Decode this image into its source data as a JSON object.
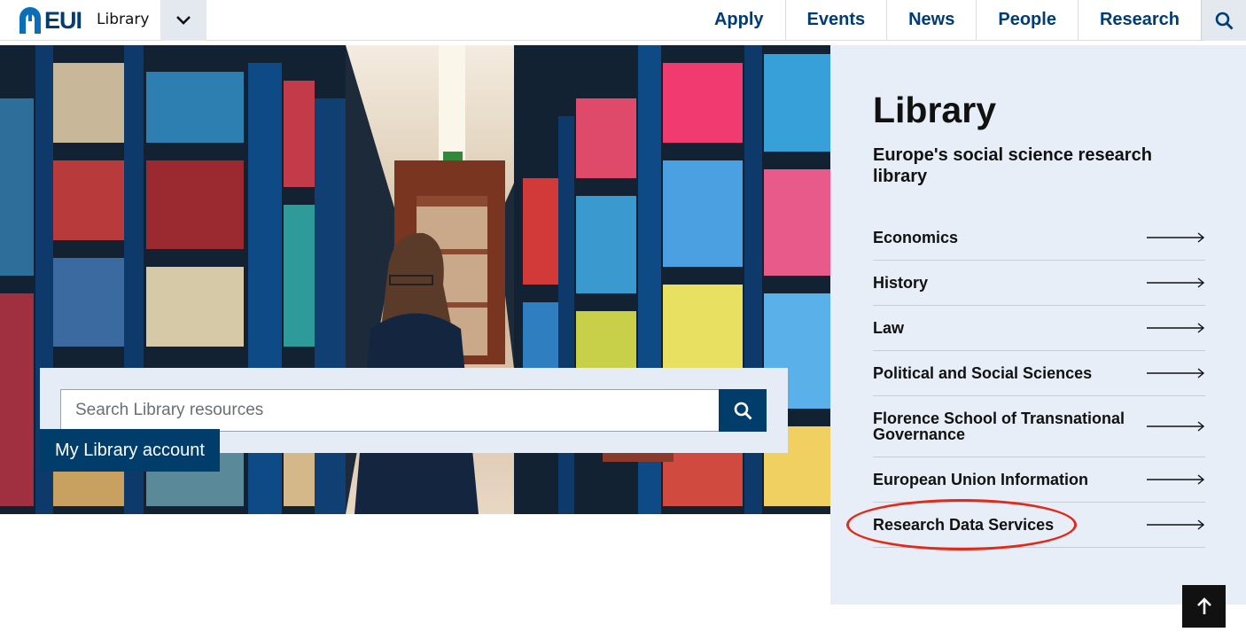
{
  "header": {
    "logo_text": "EUI",
    "site_name": "Library",
    "dropdown_icon": "chevron-down-icon",
    "nav": [
      "Apply",
      "Events",
      "News",
      "People",
      "Research"
    ],
    "search_icon": "search-icon"
  },
  "hero": {
    "search_placeholder": "Search Library resources",
    "search_button_icon": "search-icon",
    "account_button": "My Library account"
  },
  "side": {
    "title": "Library",
    "subtitle": "Europe's social science research library",
    "links": [
      "Economics",
      "History",
      "Law",
      "Political and Social Sciences",
      "Florence School of Transnational Governance",
      "European Union Information",
      "Research Data Services"
    ],
    "highlighted_link": "Research Data Services",
    "highlight_color": "#e02a1a"
  },
  "back_to_top_icon": "arrow-up-icon",
  "colors": {
    "brand": "#003d75",
    "button": "#003d6b",
    "panel": "#e8eef7"
  }
}
